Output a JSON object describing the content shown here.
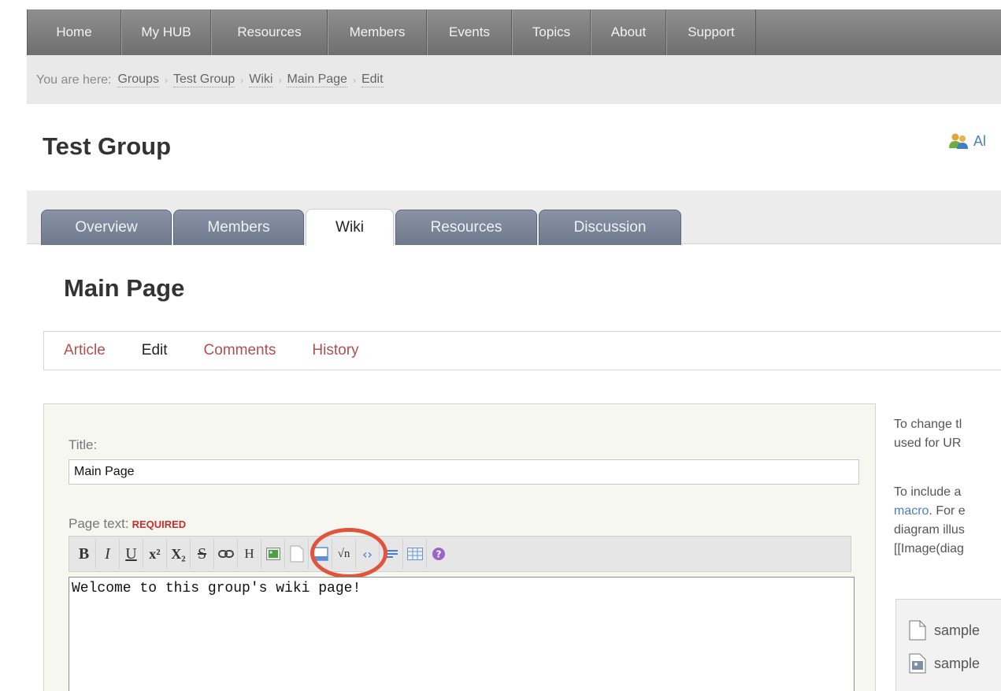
{
  "nav": [
    "Home",
    "My HUB",
    "Resources",
    "Members",
    "Events",
    "Topics",
    "About",
    "Support"
  ],
  "breadcrumb": {
    "prefix": "You are here:",
    "items": [
      "Groups",
      "Test Group",
      "Wiki",
      "Main Page",
      "Edit"
    ]
  },
  "group": {
    "title": "Test Group",
    "side_link": "Al"
  },
  "tabs": [
    "Overview",
    "Members",
    "Wiki",
    "Resources",
    "Discussion"
  ],
  "active_tab": "Wiki",
  "page": {
    "title": "Main Page"
  },
  "subtabs": [
    "Article",
    "Edit",
    "Comments",
    "History"
  ],
  "form": {
    "title_label": "Title:",
    "title_value": "Main Page",
    "text_label": "Page text:",
    "required": "REQUIRED",
    "editor_text": "Welcome to this group's wiki page!"
  },
  "toolbar": {
    "bold": "B",
    "italic": "I",
    "underline": "U",
    "superscript": "x²",
    "subscript": "X₂",
    "strike": "S",
    "heading": "H"
  },
  "help": {
    "line1": "To change tl",
    "line2": "used for UR",
    "line3": "To include a",
    "line4_link": "macro",
    "line4_rest": ". For e",
    "line5": "diagram illus",
    "line6": "[[Image(diag"
  },
  "files": [
    "sample",
    "sample"
  ],
  "colors": {
    "nav_bg": "#7f7f7f",
    "tab_bg": "#7c8599",
    "link": "#4a7fc1",
    "subtab_link": "#b04f4f",
    "required": "#c43030",
    "highlight": "#e2533b"
  }
}
